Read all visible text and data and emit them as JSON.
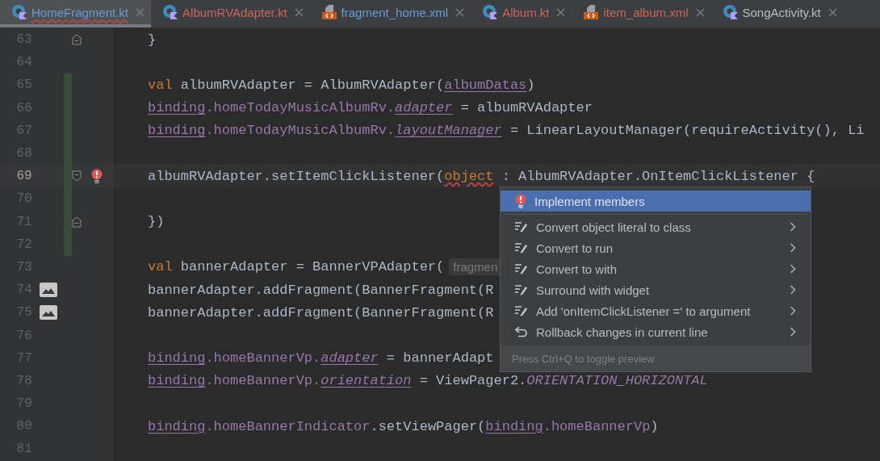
{
  "tabs": [
    {
      "label": "HomeFragment.kt",
      "kind": "kotlin",
      "color": "#6b9bd2",
      "selected": true,
      "error_underline": true
    },
    {
      "label": "AlbumRVAdapter.kt",
      "kind": "kotlin",
      "color": "#d2635a",
      "selected": false,
      "error_underline": false
    },
    {
      "label": "fragment_home.xml",
      "kind": "xml",
      "color": "#6b9bd2",
      "selected": false,
      "error_underline": false
    },
    {
      "label": "Album.kt",
      "kind": "kotlin",
      "color": "#d2635a",
      "selected": false,
      "error_underline": false
    },
    {
      "label": "item_album.xml",
      "kind": "xml",
      "color": "#d2635a",
      "selected": false,
      "error_underline": false
    },
    {
      "label": "SongActivity.kt",
      "kind": "kotlin",
      "color": "#bbbbbb",
      "selected": false,
      "error_underline": false
    }
  ],
  "editor": {
    "lines": [
      {
        "number": "63",
        "changed": false,
        "current": false,
        "fold_start": false,
        "fold_end": true,
        "error_bulb": false,
        "image_marker": false,
        "tokens": [
          {
            "kind": "plain",
            "text": "}"
          }
        ]
      },
      {
        "number": "64",
        "changed": false,
        "current": false,
        "fold_start": false,
        "fold_end": false,
        "error_bulb": false,
        "image_marker": false
      },
      {
        "number": "65",
        "changed": true,
        "current": false,
        "fold_start": false,
        "fold_end": false,
        "error_bulb": false,
        "image_marker": false,
        "tokens": [
          {
            "kind": "kw",
            "text": "val"
          },
          {
            "kind": "plain",
            "text": " albumRVAdapter = AlbumRVAdapter("
          },
          {
            "kind": "ref",
            "text": "albumDatas"
          },
          {
            "kind": "plain",
            "text": ")"
          }
        ]
      },
      {
        "number": "66",
        "changed": true,
        "current": false,
        "fold_start": false,
        "fold_end": false,
        "error_bulb": false,
        "image_marker": false,
        "tokens": [
          {
            "kind": "ref",
            "text": "binding"
          },
          {
            "kind": "field",
            "text": ".homeTodayMusicAlbumRv."
          },
          {
            "kind": "ref_italic",
            "text": "adapter"
          },
          {
            "kind": "plain",
            "text": " = albumRVAdapter"
          }
        ]
      },
      {
        "number": "67",
        "changed": true,
        "current": false,
        "fold_start": false,
        "fold_end": false,
        "error_bulb": false,
        "image_marker": false,
        "tokens": [
          {
            "kind": "ref",
            "text": "binding"
          },
          {
            "kind": "field",
            "text": ".homeTodayMusicAlbumRv."
          },
          {
            "kind": "ref_italic",
            "text": "layoutManager"
          },
          {
            "kind": "plain",
            "text": " = LinearLayoutManager(requireActivity(), Li"
          }
        ]
      },
      {
        "number": "68",
        "changed": true,
        "current": false,
        "fold_start": false,
        "fold_end": false,
        "error_bulb": false,
        "image_marker": false
      },
      {
        "number": "69",
        "changed": true,
        "current": true,
        "fold_start": true,
        "fold_end": false,
        "error_bulb": true,
        "image_marker": false,
        "tokens": [
          {
            "kind": "plain",
            "text": "albumRVAdapter.setItemClickListener("
          },
          {
            "kind": "error_kw",
            "text": "object"
          },
          {
            "kind": "plain",
            "text": " : AlbumRVAdapter.OnItemClickListener {"
          }
        ]
      },
      {
        "number": "70",
        "changed": true,
        "current": false,
        "fold_start": false,
        "fold_end": false,
        "error_bulb": false,
        "image_marker": false
      },
      {
        "number": "71",
        "changed": true,
        "current": false,
        "fold_start": false,
        "fold_end": true,
        "error_bulb": false,
        "image_marker": false,
        "tokens": [
          {
            "kind": "plain",
            "text": "})"
          }
        ]
      },
      {
        "number": "72",
        "changed": true,
        "current": false,
        "fold_start": false,
        "fold_end": false,
        "error_bulb": false,
        "image_marker": false
      },
      {
        "number": "73",
        "changed": false,
        "current": false,
        "fold_start": false,
        "fold_end": false,
        "error_bulb": false,
        "image_marker": false,
        "hint": "fragmen",
        "tokens": [
          {
            "kind": "kw",
            "text": "val"
          },
          {
            "kind": "plain",
            "text": " bannerAdapter = BannerVPAdapter("
          }
        ]
      },
      {
        "number": "74",
        "changed": false,
        "current": false,
        "fold_start": false,
        "fold_end": false,
        "error_bulb": false,
        "image_marker": true,
        "tokens": [
          {
            "kind": "plain",
            "text": "bannerAdapter.addFragment(BannerFragment(R"
          }
        ]
      },
      {
        "number": "75",
        "changed": false,
        "current": false,
        "fold_start": false,
        "fold_end": false,
        "error_bulb": false,
        "image_marker": true,
        "tokens": [
          {
            "kind": "plain",
            "text": "bannerAdapter.addFragment(BannerFragment(R"
          }
        ]
      },
      {
        "number": "76",
        "changed": false,
        "current": false,
        "fold_start": false,
        "fold_end": false,
        "error_bulb": false,
        "image_marker": false
      },
      {
        "number": "77",
        "changed": false,
        "current": false,
        "fold_start": false,
        "fold_end": false,
        "error_bulb": false,
        "image_marker": false,
        "tokens": [
          {
            "kind": "ref",
            "text": "binding"
          },
          {
            "kind": "field",
            "text": ".homeBannerVp."
          },
          {
            "kind": "ref_italic",
            "text": "adapter"
          },
          {
            "kind": "plain",
            "text": " = bannerAdapt"
          }
        ]
      },
      {
        "number": "78",
        "changed": false,
        "current": false,
        "fold_start": false,
        "fold_end": false,
        "error_bulb": false,
        "image_marker": false,
        "tokens": [
          {
            "kind": "ref",
            "text": "binding"
          },
          {
            "kind": "field",
            "text": ".homeBannerVp."
          },
          {
            "kind": "ref_italic",
            "text": "orientation"
          },
          {
            "kind": "plain",
            "text": " = ViewPager2."
          },
          {
            "kind": "const",
            "text": "ORIENTATION_HORIZONTAL"
          }
        ]
      },
      {
        "number": "79",
        "changed": false,
        "current": false,
        "fold_start": false,
        "fold_end": false,
        "error_bulb": false,
        "image_marker": false
      },
      {
        "number": "80",
        "changed": false,
        "current": false,
        "fold_start": false,
        "fold_end": false,
        "error_bulb": false,
        "image_marker": false,
        "tokens": [
          {
            "kind": "ref",
            "text": "binding"
          },
          {
            "kind": "field",
            "text": ".homeBannerIndicator"
          },
          {
            "kind": "plain",
            "text": ".setViewPager("
          },
          {
            "kind": "ref",
            "text": "binding"
          },
          {
            "kind": "field",
            "text": ".homeBannerVp"
          },
          {
            "kind": "plain",
            "text": ")"
          }
        ]
      },
      {
        "number": "81",
        "changed": false,
        "current": false,
        "fold_start": false,
        "fold_end": false,
        "error_bulb": false,
        "image_marker": false
      }
    ]
  },
  "popup": {
    "items": [
      {
        "label": "Implement members",
        "kind": "error",
        "selected": true,
        "submenu": false
      },
      {
        "label": "Convert object literal to class",
        "kind": "intention",
        "selected": false,
        "submenu": true
      },
      {
        "label": "Convert to run",
        "kind": "intention",
        "selected": false,
        "submenu": true
      },
      {
        "label": "Convert to with",
        "kind": "intention",
        "selected": false,
        "submenu": true
      },
      {
        "label": "Surround with widget",
        "kind": "intention",
        "selected": false,
        "submenu": true
      },
      {
        "label": "Add 'onItemClickListener =' to argument",
        "kind": "intention",
        "selected": false,
        "submenu": true
      },
      {
        "label": "Rollback changes in current line",
        "kind": "rollback",
        "selected": false,
        "submenu": true
      }
    ],
    "footer": "Press Ctrl+Q to toggle preview"
  }
}
